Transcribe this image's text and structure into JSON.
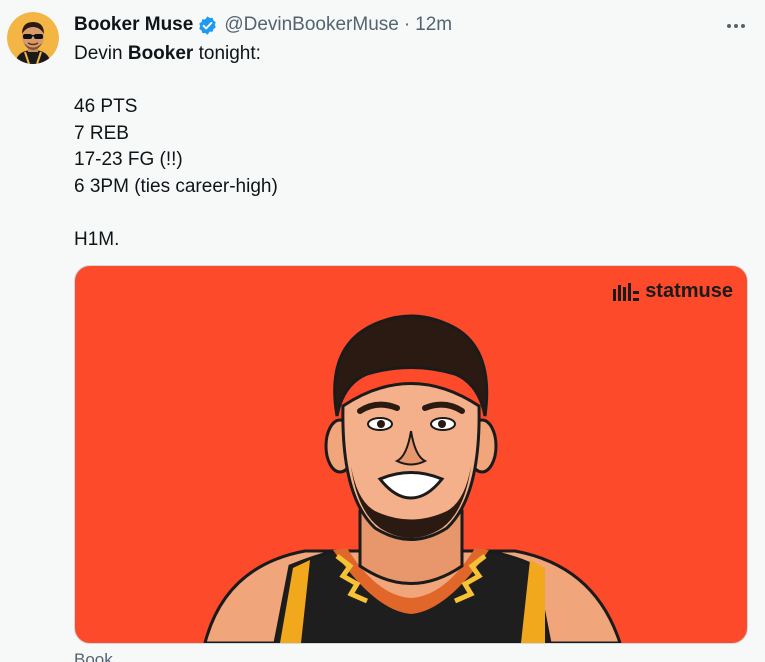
{
  "user": {
    "display_name": "Booker Muse",
    "handle": "@DevinBookerMuse",
    "separator": "·",
    "time": "12m"
  },
  "tweet": {
    "line1_prefix": "Devin ",
    "line1_bold": "Booker",
    "line1_suffix": " tonight:",
    "stats": [
      "46 PTS",
      "7 REB",
      "17-23 FG (!!)",
      "6 3PM (ties career-high)"
    ],
    "closing": "H1M."
  },
  "media": {
    "brand": "statmuse",
    "background": "#fd4a2b"
  },
  "below_text": "Book",
  "icons": {
    "verified": "verified-badge-icon",
    "more": "more-options-icon",
    "brand": "statmuse-logo-icon"
  },
  "colors": {
    "verified": "#1d9bf0",
    "secondary_text": "#536471",
    "media_bg": "#fd4a2b"
  }
}
